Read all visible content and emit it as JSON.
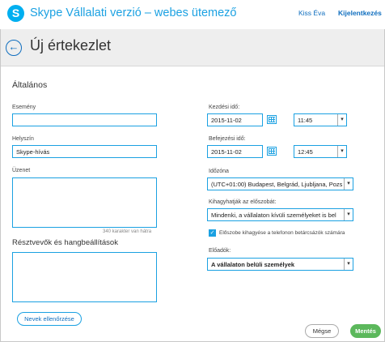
{
  "header": {
    "app_title": "Skype Vállalati verzió – webes ütemező",
    "logo_letter": "S",
    "user_name": "Kiss Éva",
    "signout": "Kijelentkezés"
  },
  "titlebar": {
    "back_glyph": "←",
    "title": "Új értekezlet"
  },
  "form": {
    "section_title": "Általános",
    "event_label": "Esemény",
    "event_value": "",
    "location_label": "Helyszín",
    "location_value": "Skype-hívás",
    "message_label": "Üzenet",
    "message_counter": "340 karakter van hátra",
    "participants_heading": "Résztvevők és hangbeállítások",
    "check_names_button": "Nevek ellenőrzése",
    "start_label": "Kezdési idő:",
    "start_date": "2015-11-02",
    "start_time": "11:45",
    "end_label": "Befejezési idő:",
    "end_date": "2015-11-02",
    "end_time": "12:45",
    "timezone_label": "Időzóna",
    "timezone_value": "(UTC+01:00) Budapest, Belgrád, Ljubljana, Pozs",
    "lobby_label": "Kihagyhatják az előszobát:",
    "lobby_value": "Mindenki, a vállalaton kívüli személyeket is bel",
    "lobby_checkbox_label": "Előszobe kihagyése a telefonon betárcsázók számára",
    "lobby_checked": true,
    "presenters_label": "Előadók:",
    "presenters_value": "A vállalaton belüli személyek",
    "cancel_button": "Mégse",
    "save_button": "Mentés"
  },
  "icons": {
    "dropdown": "chevron-down-icon",
    "calendar": "calendar-icon",
    "back": "arrow-left-icon"
  },
  "colors": {
    "accent": "#1ba1e2",
    "link": "#0f6ebf",
    "save": "#5cb85c",
    "titlebar_bg": "#eeeeee"
  }
}
